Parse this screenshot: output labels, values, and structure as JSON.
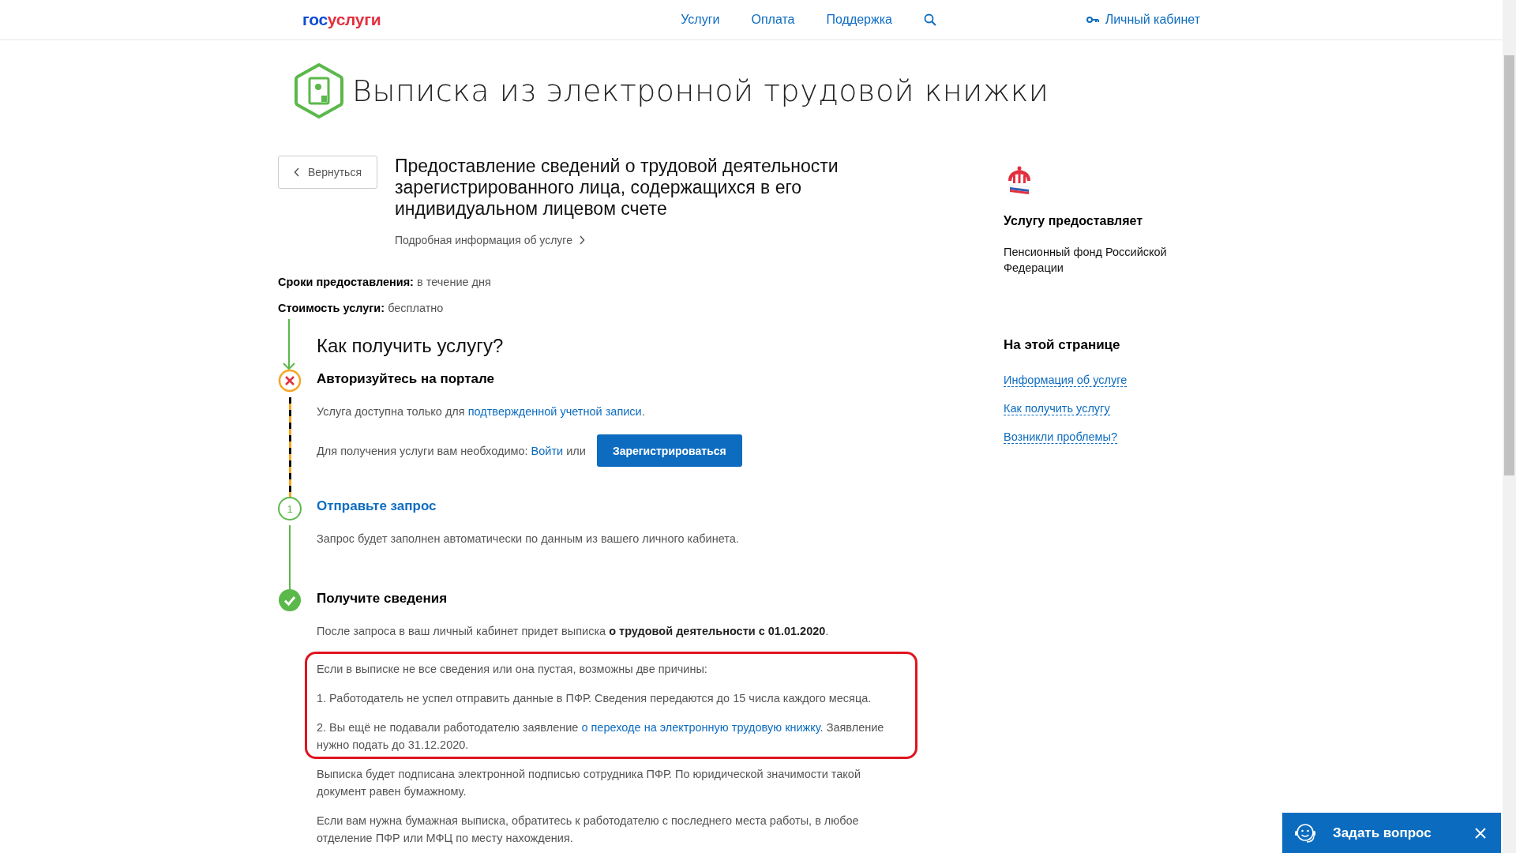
{
  "header": {
    "logo": {
      "first": "гос",
      "second": "услуги"
    },
    "nav": [
      "Услуги",
      "Оплата",
      "Поддержка"
    ],
    "account": "Личный кабинет"
  },
  "page_title": "Выписка из электронной трудовой книжки",
  "back_button": "Вернуться",
  "service_title": "Предоставление сведений о трудовой деятельности зарегистрированного лица, содержащихся в его индивидуальном лицевом счете",
  "details_link": "Подробная информация об услуге",
  "facts": [
    {
      "label": "Сроки предоставления:",
      "value": "в течение дня"
    },
    {
      "label": "Стоимость услуги:",
      "value": "бесплатно"
    }
  ],
  "how_heading": "Как получить услугу?",
  "steps": [
    {
      "kind": "error",
      "title": "Авторизуйтесь на портале",
      "paragraphs": [
        {
          "text": "Услуга доступна только для",
          "link": "подтвержденной учетной записи",
          "after": "."
        }
      ],
      "action": {
        "text": "Для получения услуги вам необходимо:",
        "link": "Войти",
        "after": "или",
        "button": "Зарегистрироваться"
      }
    },
    {
      "kind": "number",
      "number": "1",
      "title": "Отправьте запрос",
      "paragraphs": [
        {
          "text": "Запрос будет заполнен автоматически по данным из вашего личного кабинета."
        }
      ]
    },
    {
      "kind": "done",
      "title": "Получите сведения",
      "paragraphs": [
        {
          "text": "После запроса в ваш личный кабинет придет выписка **о трудовой деятельности с 01.01.2020**."
        }
      ],
      "callout": {
        "outlined": true,
        "paragraphs": [
          {
            "text": "Если в выписке не все сведения или она пустая, возможны две причины:"
          },
          {
            "text": "1. Работодатель не успел отправить данные в ПФР. Сведения передаются до 15 числа каждого месяца."
          },
          {
            "text": "2. Вы ещё не подавали работодателю заявление",
            "link": "о переходе на электронную трудовую книжку",
            "after": ". Заявление нужно подать до 31.12.2020."
          }
        ]
      },
      "notes": [
        {
          "text": "Выписка будет подписана электронной подписью сотрудника ПФР. По юридической значимости такой документ равен бумажному."
        },
        {
          "text": "Если вам нужна бумажная выписка, обратитесь к работодателю с последнего места работы, в любое отделение ПФР или МФЦ по месту нахождения."
        }
      ]
    }
  ],
  "provider": {
    "heading": "Услугу предоставляет",
    "name": "Пенсионный фонд Российской Федерации"
  },
  "on_page": {
    "heading": "На этой странице",
    "links": [
      "Информация об услуге",
      "Как получить услугу",
      "Возникли проблемы?"
    ]
  },
  "chat": {
    "label": "Задать вопрос"
  }
}
